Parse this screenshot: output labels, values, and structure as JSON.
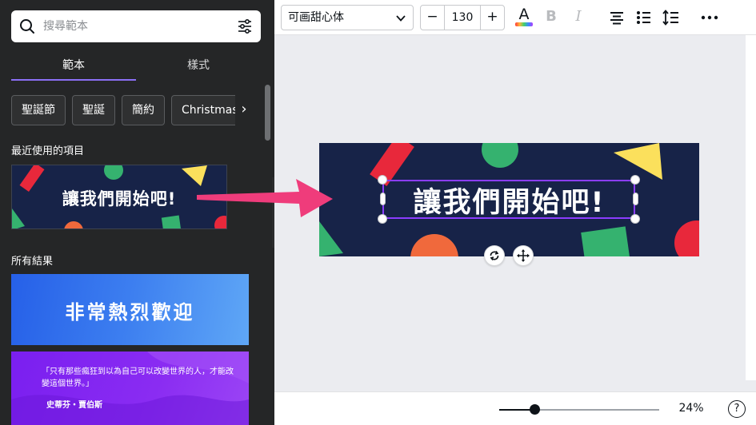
{
  "left_panel": {
    "search": {
      "placeholder": "搜尋範本"
    },
    "tabs": [
      {
        "label": "範本",
        "active": true
      },
      {
        "label": "樣式",
        "active": false
      }
    ],
    "chips": [
      "聖誕節",
      "聖誕",
      "簡約",
      "Christmas"
    ],
    "recent_title": "最近使用的項目",
    "recent_thumb_text": "讓我們開始吧!",
    "all_title": "所有結果",
    "results": [
      {
        "text": "非常熱烈歡迎"
      },
      {
        "quote": "「只有那些瘋狂到以為自己可以改變世界的人，才能改變這個世界。」",
        "author": "史蒂芬・賈伯斯"
      }
    ],
    "collapse_icon": "‹"
  },
  "toolbar": {
    "font_name": "可画甜心体",
    "minus": "−",
    "font_size": "130",
    "plus": "+",
    "text_color_letter": "A",
    "bold_letter": "B",
    "italic_letter": "I"
  },
  "canvas": {
    "design_text": "讓我們開始吧!",
    "background_color": "#172348",
    "accent_color": "#8b3dff"
  },
  "footer": {
    "zoom_value": "24%",
    "zoom_level": 0.24,
    "help_label": "?"
  },
  "icons": {
    "search": "search-icon",
    "filter": "filter-icon",
    "chevron": "chevron-down-icon",
    "text_color": "text-color-icon",
    "bold": "bold-icon",
    "italic": "italic-icon",
    "align": "align-center-icon",
    "list": "list-icon",
    "spacing": "line-spacing-icon",
    "more": "more-icon",
    "rotate": "rotate-icon",
    "move": "move-icon"
  }
}
